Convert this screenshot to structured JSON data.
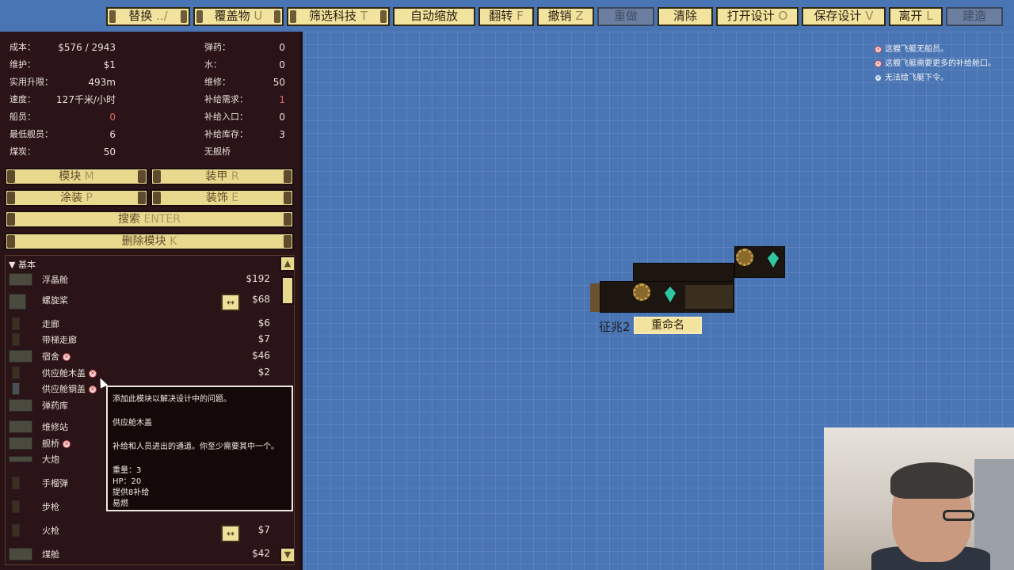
{
  "toolbar": {
    "buttons": [
      {
        "label": "替换",
        "hotkey": "../"
      },
      {
        "label": "覆盖物",
        "hotkey": "U"
      },
      {
        "label": "筛选科技",
        "hotkey": "T"
      },
      {
        "label": "自动缩放",
        "hotkey": ""
      },
      {
        "label": "翻转",
        "hotkey": "F"
      },
      {
        "label": "撤销",
        "hotkey": "Z"
      },
      {
        "label": "重做",
        "hotkey": ""
      },
      {
        "label": "清除",
        "hotkey": ""
      },
      {
        "label": "打开设计",
        "hotkey": "O"
      },
      {
        "label": "保存设计",
        "hotkey": "V"
      },
      {
        "label": "离开",
        "hotkey": "L"
      },
      {
        "label": "建造",
        "hotkey": ""
      }
    ]
  },
  "stats": {
    "left": [
      {
        "label": "成本：",
        "value": "$576 / 2943"
      },
      {
        "label": "维护：",
        "value": "$1"
      },
      {
        "label": "实用升限：",
        "value": "493m"
      },
      {
        "label": "速度：",
        "value": "127千米/小时"
      },
      {
        "label": "船员：",
        "value": "0"
      },
      {
        "label": "最低舰员：",
        "value": "6"
      },
      {
        "label": "煤炭：",
        "value": "50"
      }
    ],
    "right": [
      {
        "label": "弹药：",
        "value": "0"
      },
      {
        "label": "水：",
        "value": "0"
      },
      {
        "label": "维修：",
        "value": "50"
      },
      {
        "label": "补给需求：",
        "value": "1"
      },
      {
        "label": "补给入口：",
        "value": "0"
      },
      {
        "label": "补给库存：",
        "value": "3"
      },
      {
        "label": "无舰桥",
        "value": ""
      }
    ]
  },
  "panel_buttons": {
    "modules": {
      "label": "模块",
      "hotkey": "M"
    },
    "armor": {
      "label": "装甲",
      "hotkey": "R"
    },
    "paint": {
      "label": "涂装",
      "hotkey": "P"
    },
    "decor": {
      "label": "装饰",
      "hotkey": "E"
    },
    "search": {
      "label": "搜索",
      "hotkey": "ENTER"
    },
    "delete": {
      "label": "删除模块",
      "hotkey": "K"
    }
  },
  "module_list": {
    "category": "基本",
    "items": [
      {
        "name": "浮晶舱",
        "price": "$192",
        "warn": false
      },
      {
        "name": "螺旋桨",
        "price": "$68",
        "warn": false
      },
      {
        "name": "走廊",
        "price": "$6",
        "warn": false
      },
      {
        "name": "带梯走廊",
        "price": "$7",
        "warn": false
      },
      {
        "name": "宿舍",
        "price": "$46",
        "warn": true
      },
      {
        "name": "供应舱木盖",
        "price": "$2",
        "warn": true
      },
      {
        "name": "供应舱钢盖",
        "price": "",
        "warn": true
      },
      {
        "name": "弹药库",
        "price": "",
        "warn": false
      },
      {
        "name": "维修站",
        "price": "",
        "warn": false
      },
      {
        "name": "舰桥",
        "price": "",
        "warn": true
      },
      {
        "name": "大炮",
        "price": "",
        "warn": false
      },
      {
        "name": "手榴弹",
        "price": "",
        "warn": false
      },
      {
        "name": "步枪",
        "price": "",
        "warn": false
      },
      {
        "name": "火枪",
        "price": "$7",
        "warn": false
      },
      {
        "name": "煤舱",
        "price": "$42",
        "warn": false
      }
    ],
    "flip_symbol": "↔"
  },
  "tooltip": {
    "hint": "添加此模块以解决设计中的问题。",
    "title": "供应舱木盖",
    "description": "补给和人员进出的通道。你至少需要其中一个。",
    "weight": "重量：3",
    "hp": "HP：20",
    "supply": "提供8补给",
    "flammable": "易燃"
  },
  "ship": {
    "name": "征兆2",
    "rename_label": "重命名"
  },
  "warnings": [
    {
      "text": "这艘飞艇无船员。",
      "type": "error"
    },
    {
      "text": "这艘飞艇需要更多的补给舱口。",
      "type": "error"
    },
    {
      "text": "无法给飞艇下令。",
      "type": "info"
    }
  ],
  "colors": {
    "background": "#4a75b5",
    "panel": "#2a1418",
    "button": "#f2e39e",
    "warning_red": "#e06a6a"
  }
}
